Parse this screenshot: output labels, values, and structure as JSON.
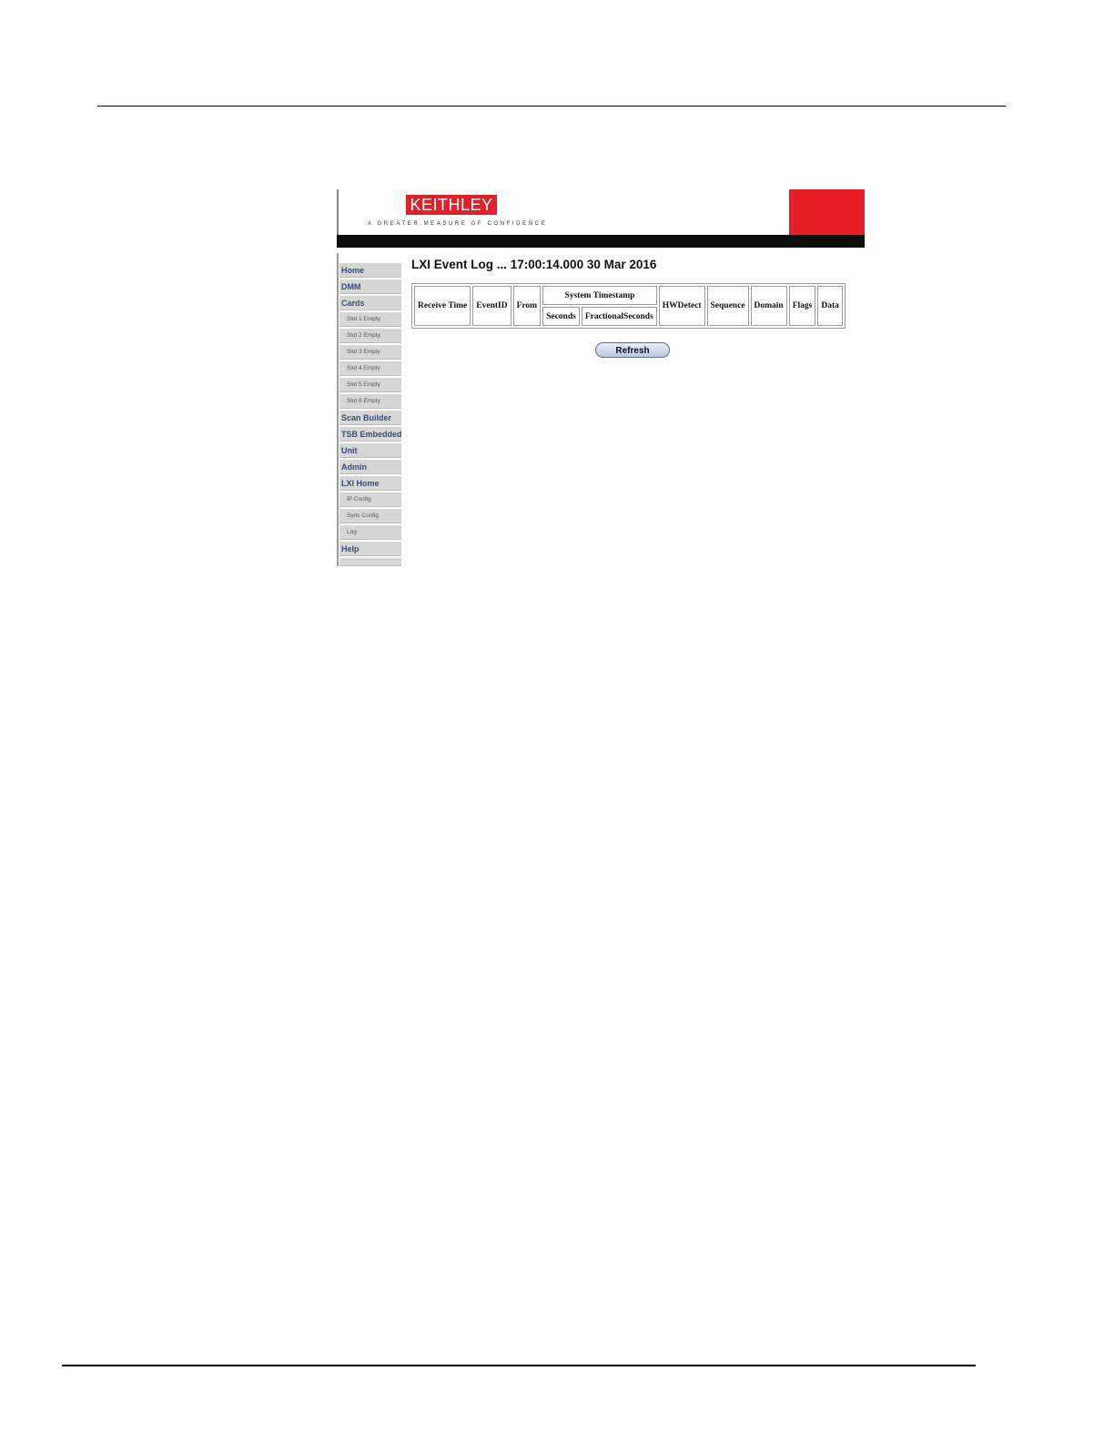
{
  "banner": {
    "logo_text": "KEITHLEY",
    "tagline": "A GREATER MEASURE OF CONFIDENCE",
    "brand_color": "#e81e26"
  },
  "sidebar": {
    "items": [
      {
        "label": "Home",
        "sub": false
      },
      {
        "label": "DMM",
        "sub": false
      },
      {
        "label": "Cards",
        "sub": false
      },
      {
        "label": "Slot 1 Empty",
        "sub": true
      },
      {
        "label": "Slot 2 Empty",
        "sub": true
      },
      {
        "label": "Slot 3 Empty",
        "sub": true
      },
      {
        "label": "Slot 4 Empty",
        "sub": true
      },
      {
        "label": "Slot 5 Empty",
        "sub": true
      },
      {
        "label": "Slot 6 Empty",
        "sub": true
      },
      {
        "label": "Scan Builder",
        "sub": false
      },
      {
        "label": "TSB Embedded",
        "sub": false
      },
      {
        "label": "Unit",
        "sub": false
      },
      {
        "label": "Admin",
        "sub": false
      },
      {
        "label": "LXI Home",
        "sub": false
      },
      {
        "label": "IP Config",
        "sub": true
      },
      {
        "label": "Sync Config",
        "sub": true
      },
      {
        "label": "Log",
        "sub": true
      },
      {
        "label": "Help",
        "sub": false
      }
    ]
  },
  "main": {
    "title": "LXI Event Log ... 17:00:14.000 30 Mar 2016",
    "table": {
      "receive_time": "Receive Time",
      "event_id": "EventID",
      "from": "From",
      "system_timestamp": "System Timestamp",
      "seconds": "Seconds",
      "fractional_seconds": "FractionalSeconds",
      "hw_detect": "HWDetect",
      "sequence": "Sequence",
      "domain": "Domain",
      "flags": "Flags",
      "data": "Data"
    },
    "refresh_label": "Refresh"
  }
}
